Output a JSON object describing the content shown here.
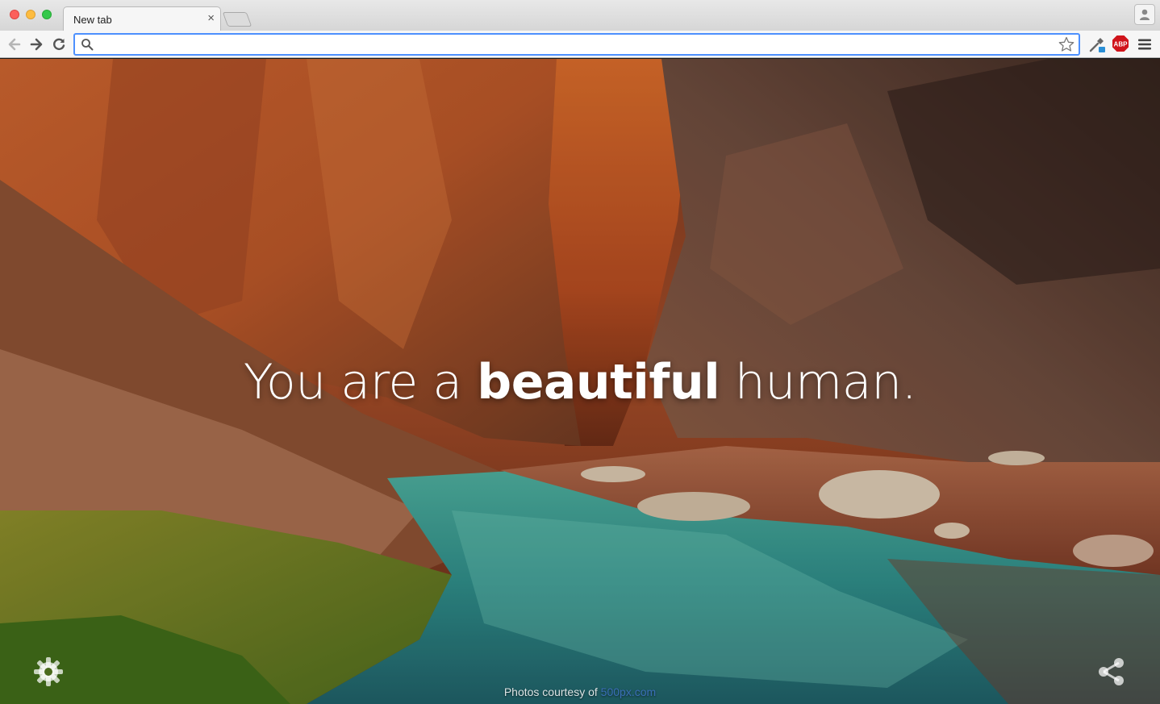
{
  "window": {
    "tab_title": "New tab",
    "tab_close": "×"
  },
  "toolbar": {
    "back_icon": "back-arrow-icon",
    "forward_icon": "forward-arrow-icon",
    "reload_icon": "reload-icon",
    "omnibox": {
      "value": "",
      "placeholder": ""
    },
    "extensions": [
      "eyedropper-icon",
      "adblock-plus-icon"
    ],
    "abp_label": "ABP"
  },
  "page": {
    "headline_pre": "You are a ",
    "headline_bold": "beautiful",
    "headline_post": " human.",
    "credit_text": "Photos courtesy of ",
    "credit_link": "500px.com"
  },
  "colors": {
    "omnibox_focus": "#4d90fe",
    "abp_red": "#d0141b",
    "headline": "#ffffff"
  }
}
